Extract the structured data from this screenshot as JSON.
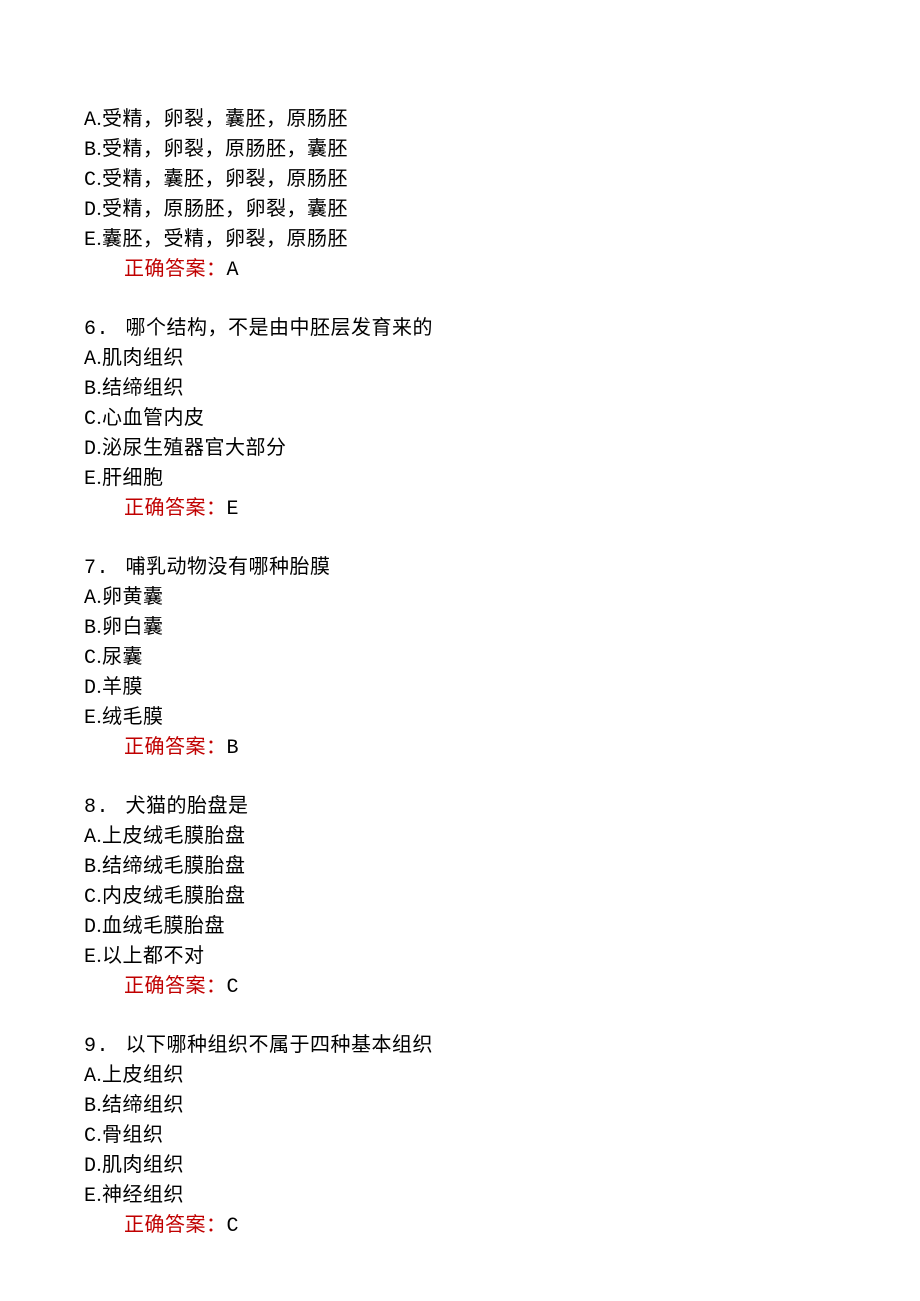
{
  "prev_options": [
    {
      "letter": "A",
      "text": "受精，卵裂，囊胚，原肠胚"
    },
    {
      "letter": "B",
      "text": "受精，卵裂，原肠胚，囊胚"
    },
    {
      "letter": "C",
      "text": "受精，囊胚，卵裂，原肠胚"
    },
    {
      "letter": "D",
      "text": "受精，原肠胚，卵裂，囊胚"
    },
    {
      "letter": "E",
      "text": "囊胚，受精，卵裂，原肠胚"
    }
  ],
  "prev_answer_label": "正确答案：",
  "prev_answer_value": "A",
  "questions": [
    {
      "num": "6.",
      "stem": "哪个结构，不是由中胚层发育来的",
      "options": [
        {
          "letter": "A",
          "text": "肌肉组织"
        },
        {
          "letter": "B",
          "text": "结缔组织"
        },
        {
          "letter": "C",
          "text": "心血管内皮"
        },
        {
          "letter": "D",
          "text": "泌尿生殖器官大部分"
        },
        {
          "letter": "E",
          "text": "肝细胞"
        }
      ],
      "answer_label": "正确答案：",
      "answer_value": "E"
    },
    {
      "num": "7.",
      "stem": "哺乳动物没有哪种胎膜",
      "options": [
        {
          "letter": "A",
          "text": "卵黄囊"
        },
        {
          "letter": "B",
          "text": "卵白囊"
        },
        {
          "letter": "C",
          "text": "尿囊"
        },
        {
          "letter": "D",
          "text": "羊膜"
        },
        {
          "letter": "E",
          "text": "绒毛膜"
        }
      ],
      "answer_label": "正确答案：",
      "answer_value": "B"
    },
    {
      "num": "8.",
      "stem": "犬猫的胎盘是",
      "options": [
        {
          "letter": "A",
          "text": "上皮绒毛膜胎盘"
        },
        {
          "letter": "B",
          "text": "结缔绒毛膜胎盘"
        },
        {
          "letter": "C",
          "text": "内皮绒毛膜胎盘"
        },
        {
          "letter": "D",
          "text": "血绒毛膜胎盘"
        },
        {
          "letter": "E",
          "text": "以上都不对"
        }
      ],
      "answer_label": "正确答案：",
      "answer_value": "C"
    },
    {
      "num": "9.",
      "stem": "以下哪种组织不属于四种基本组织",
      "options": [
        {
          "letter": "A",
          "text": "上皮组织"
        },
        {
          "letter": "B",
          "text": "结缔组织"
        },
        {
          "letter": "C",
          "text": "骨组织"
        },
        {
          "letter": "D",
          "text": "肌肉组织"
        },
        {
          "letter": "E",
          "text": "神经组织"
        }
      ],
      "answer_label": "正确答案：",
      "answer_value": "C"
    }
  ]
}
